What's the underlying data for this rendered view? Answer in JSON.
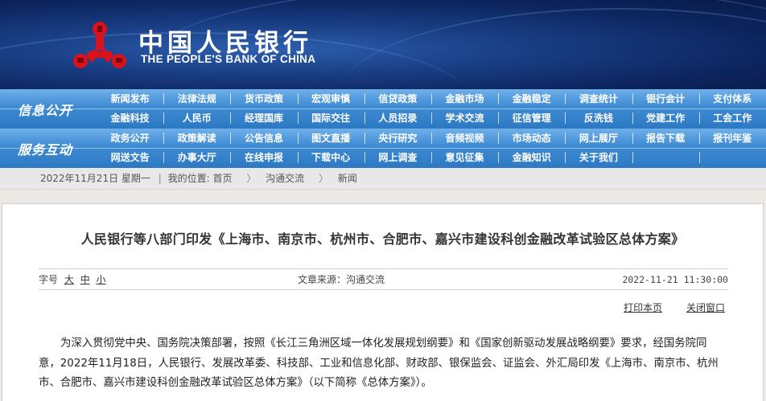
{
  "header": {
    "logo_cn": "中国人民银行",
    "logo_en": "THE PEOPLE'S BANK OF CHINA",
    "logo_icon": "pboc-emblem-icon",
    "brand_red": "#d9121b",
    "nav_blue": "#3e8ad2"
  },
  "nav": {
    "info": {
      "title": "信息公开",
      "items": [
        "新闻发布",
        "法律法规",
        "货币政策",
        "宏观审慎",
        "信贷政策",
        "金融市场",
        "金融稳定",
        "调查统计",
        "银行会计",
        "支付体系",
        "金融科技",
        "人民币",
        "经理国库",
        "国际交往",
        "人员招录",
        "学术交流",
        "征信管理",
        "反洗钱",
        "党建工作",
        "工会工作"
      ]
    },
    "service": {
      "title": "服务互动",
      "items": [
        "政务公开",
        "政策解读",
        "公告信息",
        "图文直播",
        "央行研究",
        "音频视频",
        "市场动态",
        "网上展厅",
        "报告下载",
        "报刊年鉴",
        "网送文告",
        "办事大厅",
        "在线申报",
        "下载中心",
        "网上调查",
        "意见征集",
        "金融知识",
        "关于我们",
        "",
        ""
      ]
    }
  },
  "breadcrumb": {
    "date": "2022年11月21日 星期一",
    "position_label": "我的位置:",
    "home": "首页",
    "section": "沟通交流",
    "current": "新闻"
  },
  "article": {
    "title": "人民银行等八部门印发《上海市、南京市、杭州市、合肥市、嘉兴市建设科创金融改革试验区总体方案》",
    "font_size_label": "字号",
    "font_large": "大",
    "font_medium": "中",
    "font_small": "小",
    "source": "文章来源：沟通交流",
    "datetime": "2022-11-21 11:30:00",
    "print_label": "打印本页",
    "close_label": "关闭窗口",
    "body": "为深入贯彻党中央、国务院决策部署，按照《长江三角洲区域一体化发展规划纲要》和《国家创新驱动发展战略纲要》要求，经国务院同意，2022年11月18日，人民银行、发展改革委、科技部、工业和信息化部、财政部、银保监会、证监会、外汇局印发《上海市、南京市、杭州市、合肥市、嘉兴市建设科创金融改革试验区总体方案》（以下简称《总体方案》）。"
  }
}
